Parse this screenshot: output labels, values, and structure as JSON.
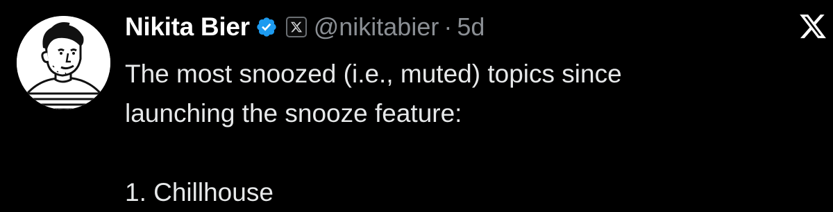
{
  "author": {
    "name": "Nikita Bier",
    "handle": "@nikitabier",
    "separator": "·",
    "time_ago": "5d",
    "verified": true,
    "badge_icon": "x-logo-icon"
  },
  "platform_logo": "x-logo-icon",
  "tweet": {
    "lines": [
      "The most snoozed (i.e., muted) topics since",
      "launching the snooze feature:"
    ],
    "list": [
      "1. Chillhouse"
    ]
  },
  "colors": {
    "background": "#000000",
    "text": "#e7e9ea",
    "secondary": "#8b8f94",
    "verified_blue": "#1d9bf0"
  }
}
